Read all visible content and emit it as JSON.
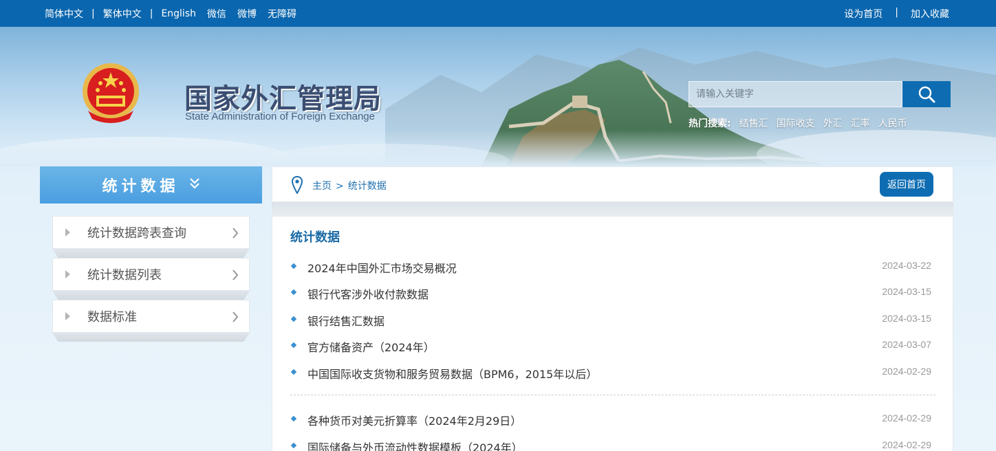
{
  "topbar": {
    "lang_simplified": "简体中文",
    "lang_traditional": "繁体中文",
    "lang_english": "English",
    "wechat": "微信",
    "weibo": "微博",
    "accessibility": "无障碍",
    "set_homepage": "设为首页",
    "add_favorite": "加入收藏",
    "separator": "|"
  },
  "header": {
    "title_cn": "国家外汇管理局",
    "title_en": "State Administration of Foreign Exchange",
    "search_placeholder": "请输入关键字",
    "hot_label": "热门搜索:",
    "hot_items": [
      "结售汇",
      "国际收支",
      "外汇",
      "汇率",
      "人民币"
    ]
  },
  "sidebar": {
    "title": "统计数据",
    "chevron": "»",
    "items": [
      {
        "label": "统计数据跨表查询"
      },
      {
        "label": "统计数据列表"
      },
      {
        "label": "数据标准"
      }
    ]
  },
  "breadcrumb": {
    "home": "主页",
    "sep": ">",
    "current": "统计数据",
    "back_button": "返回首页"
  },
  "content": {
    "title": "统计数据",
    "group1": [
      {
        "title": "2024年中国外汇市场交易概况",
        "date": "2024-03-22"
      },
      {
        "title": "银行代客涉外收付款数据",
        "date": "2024-03-15"
      },
      {
        "title": "银行结售汇数据",
        "date": "2024-03-15"
      },
      {
        "title": "官方储备资产（2024年）",
        "date": "2024-03-07"
      },
      {
        "title": "中国国际收支货物和服务贸易数据（BPM6，2015年以后）",
        "date": "2024-02-29"
      }
    ],
    "group2": [
      {
        "title": "各种货币对美元折算率（2024年2月29日）",
        "date": "2024-02-29"
      },
      {
        "title": "国际储备与外币流动性数据模板（2024年）",
        "date": "2024-02-29"
      }
    ]
  },
  "colors": {
    "topbar": "#0a66ae",
    "accent": "#0e6db2",
    "sidebar_head": "#4a9ee0",
    "title_text": "#1a6aa6"
  }
}
